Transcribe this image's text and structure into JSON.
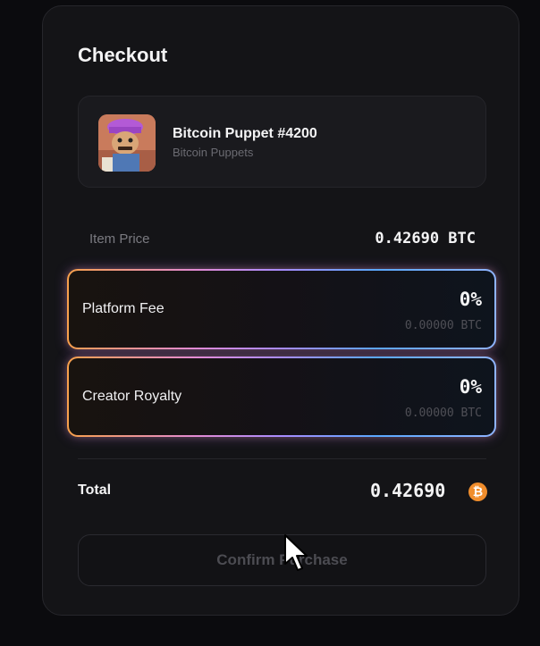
{
  "checkout": {
    "title": "Checkout",
    "item": {
      "name": "Bitcoin Puppet #4200",
      "collection": "Bitcoin Puppets"
    },
    "item_price": {
      "label": "Item Price",
      "value": "0.42690 BTC"
    },
    "fees": [
      {
        "label": "Platform Fee",
        "percent": "0%",
        "btc": "0.00000 BTC"
      },
      {
        "label": "Creator Royalty",
        "percent": "0%",
        "btc": "0.00000 BTC"
      }
    ],
    "total": {
      "label": "Total",
      "value": "0.42690",
      "currency_icon": "bitcoin-icon",
      "icon_glyph": "₿"
    },
    "confirm_label": "Confirm Purchase"
  },
  "colors": {
    "background": "#0b0b0e",
    "panel": "#141417",
    "bitcoin_orange": "#f08d2c",
    "fee_gradient_start": "#f7a04b",
    "fee_gradient_end": "#8fb4ff"
  }
}
